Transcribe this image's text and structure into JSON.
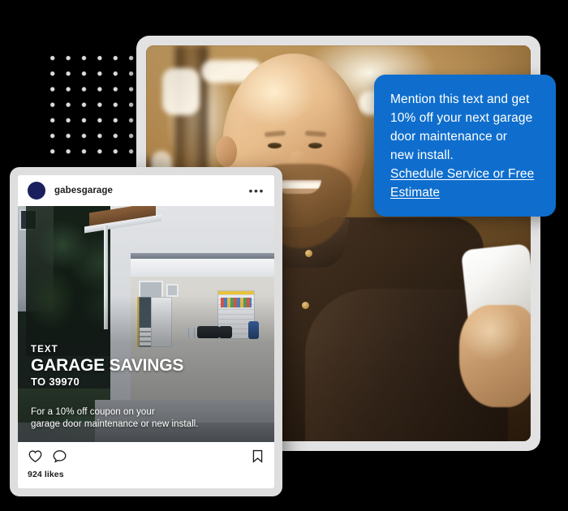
{
  "background": {
    "color": "#000000"
  },
  "decoration": {
    "dot_grid": {
      "name": "dot-grid-pattern",
      "dot_color": "#dcdcdc",
      "columns": 6,
      "rows": 7
    }
  },
  "hero_photo": {
    "alt": "Smiling bald bearded man in dark shirt looking at a white smartphone in a warm-lit workshop",
    "frame_color": "#e2e2e2"
  },
  "speech_bubble": {
    "accent_color": "#0f6ecd",
    "text_color": "#ffffff",
    "line1": "Mention this text and get",
    "line2": "10% off your next garage",
    "line3": "door maintenance or",
    "line4": "new install.",
    "link_label": "Schedule Service or Free Estimate"
  },
  "instagram_post": {
    "frame_color": "#dedede",
    "header": {
      "avatar": "profile-avatar",
      "avatar_color": "#1b1f5e",
      "username": "gabesgarage",
      "more_label": "•••"
    },
    "photo": {
      "alt": "Open residential garage at dusk with organized interior shelving, tool wall and driveway"
    },
    "overlay": {
      "kicker": "TEXT",
      "headline": "GARAGE SAVINGS",
      "subhead": "TO 39970",
      "body_line1": "For a 10% off coupon on your",
      "body_line2": "garage door maintenance or new install."
    },
    "actions": {
      "like_icon": "heart-icon",
      "comment_icon": "comment-icon",
      "save_icon": "bookmark-icon",
      "likes_label": "924 likes"
    }
  }
}
